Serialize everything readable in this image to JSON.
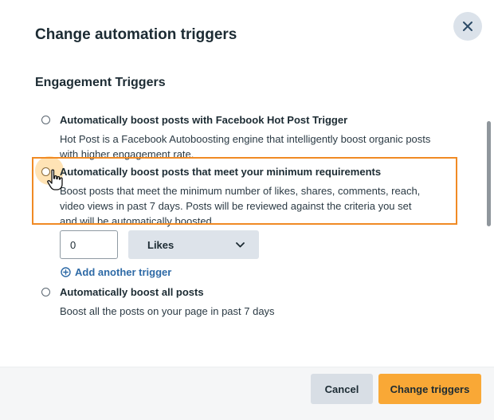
{
  "modal": {
    "title": "Change automation triggers",
    "section_title": "Engagement Triggers"
  },
  "options": [
    {
      "label": "Automatically boost posts with Facebook Hot Post Trigger",
      "description": "Hot Post is a Facebook Autoboosting engine that intelligently boost organic posts with higher engagement rate.",
      "selected": false
    },
    {
      "label": "Automatically boost posts that meet your minimum requirements",
      "description": "Boost posts that meet the minimum number of likes, shares, comments, reach, video views in past 7 days. Posts will be reviewed against the criteria you set and will be automatically boosted.",
      "selected": true
    },
    {
      "label": "Automatically boost all posts",
      "description": "Boost all the posts on your page in past 7 days",
      "selected": false
    }
  ],
  "criteria": {
    "count_value": "0",
    "metric_selected": "Likes",
    "add_trigger_label": "Add another trigger"
  },
  "footer": {
    "cancel_label": "Cancel",
    "submit_label": "Change triggers"
  },
  "icons": {
    "close": "close-icon",
    "chevron": "chevron-down-icon",
    "add": "plus-circle-icon",
    "cursor": "hand-pointer-icon"
  },
  "colors": {
    "accent": "#f9a836",
    "highlight_border": "#f08a24",
    "link": "#2e6aa6",
    "secondary_button": "#d8dee5"
  }
}
